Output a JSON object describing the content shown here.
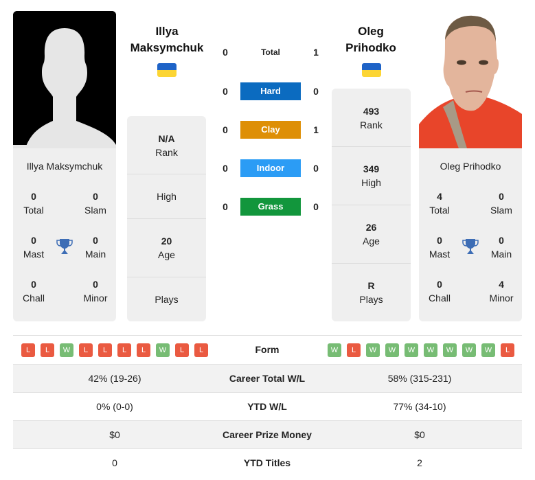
{
  "players": {
    "left": {
      "name_line1": "Illya",
      "name_line2": "Maksymchuk",
      "full_name": "Illya Maksymchuk",
      "country_flag": "ukraine-flag",
      "photo": "silhouette-placeholder",
      "titles": {
        "total": "0",
        "total_label": "Total",
        "slam": "0",
        "slam_label": "Slam",
        "mast": "0",
        "mast_label": "Mast",
        "main": "0",
        "main_label": "Main",
        "chall": "0",
        "chall_label": "Chall",
        "minor": "0",
        "minor_label": "Minor"
      },
      "info": [
        {
          "value": "N/A",
          "label": "Rank"
        },
        {
          "value": "",
          "label": "High"
        },
        {
          "value": "20",
          "label": "Age"
        },
        {
          "value": "",
          "label": "Plays"
        }
      ]
    },
    "right": {
      "name_line1": "Oleg",
      "name_line2": "Prihodko",
      "full_name": "Oleg Prihodko",
      "country_flag": "ukraine-flag",
      "photo": "player-photo",
      "titles": {
        "total": "4",
        "total_label": "Total",
        "slam": "0",
        "slam_label": "Slam",
        "mast": "0",
        "mast_label": "Mast",
        "main": "0",
        "main_label": "Main",
        "chall": "0",
        "chall_label": "Chall",
        "minor": "4",
        "minor_label": "Minor"
      },
      "info": [
        {
          "value": "493",
          "label": "Rank"
        },
        {
          "value": "349",
          "label": "High"
        },
        {
          "value": "26",
          "label": "Age"
        },
        {
          "value": "R",
          "label": "Plays"
        }
      ]
    }
  },
  "h2h": [
    {
      "label": "Total",
      "left": "0",
      "right": "1",
      "color": ""
    },
    {
      "label": "Hard",
      "left": "0",
      "right": "0",
      "color": "#0b6bc0"
    },
    {
      "label": "Clay",
      "left": "0",
      "right": "1",
      "color": "#de8f06"
    },
    {
      "label": "Indoor",
      "left": "0",
      "right": "0",
      "color": "#2b9cf5"
    },
    {
      "label": "Grass",
      "left": "0",
      "right": "0",
      "color": "#12963c"
    }
  ],
  "form": {
    "label": "Form",
    "left": [
      "L",
      "L",
      "W",
      "L",
      "L",
      "L",
      "L",
      "W",
      "L",
      "L"
    ],
    "right": [
      "W",
      "L",
      "W",
      "W",
      "W",
      "W",
      "W",
      "W",
      "W",
      "L"
    ]
  },
  "stats": [
    {
      "label": "Career Total W/L",
      "left": "42% (19-26)",
      "right": "58% (315-231)"
    },
    {
      "label": "YTD W/L",
      "left": "0% (0-0)",
      "right": "77% (34-10)"
    },
    {
      "label": "Career Prize Money",
      "left": "$0",
      "right": "$0"
    },
    {
      "label": "YTD Titles",
      "left": "0",
      "right": "2"
    }
  ],
  "colors": {
    "win": "#77bc74",
    "loss": "#ea5a41",
    "trophy": "#3d6db5"
  }
}
